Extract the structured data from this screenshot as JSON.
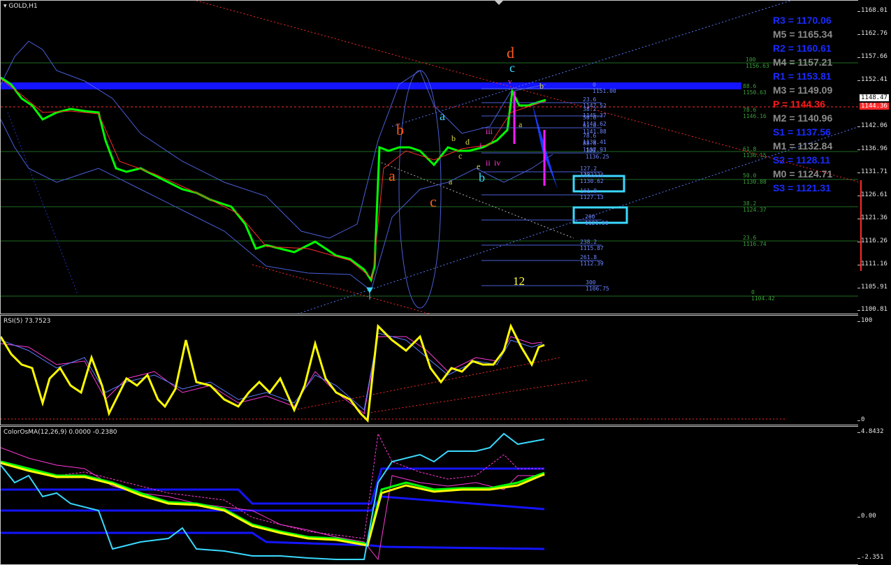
{
  "window": {
    "title": "GOLD,H1",
    "menu_icon": "triangle-down-icon"
  },
  "price_axis": {
    "ticks": [
      "1168.01",
      "1162.76",
      "1157.66",
      "1152.41",
      "1147.06",
      "1142.06",
      "1136.96",
      "1131.71",
      "1126.61",
      "1121.36",
      "1116.26",
      "1111.16",
      "1105.91",
      "1100.81"
    ],
    "current_price": "1148.47",
    "bid_label": "1144.36"
  },
  "pivots": [
    {
      "label": "R3 = 1170.06",
      "color": "#1a2bff"
    },
    {
      "label": "M5 = 1165.34",
      "color": "#8c8c8c"
    },
    {
      "label": "R2 = 1160.61",
      "color": "#1a2bff"
    },
    {
      "label": "M4 = 1157.21",
      "color": "#8c8c8c"
    },
    {
      "label": "R1 = 1153.81",
      "color": "#1a2bff"
    },
    {
      "label": "M3 = 1149.09",
      "color": "#8c8c8c"
    },
    {
      "label": "P  = 1144.36",
      "color": "#ff1a1a"
    },
    {
      "label": "M2 = 1140.96",
      "color": "#8c8c8c"
    },
    {
      "label": "S1 = 1137.56",
      "color": "#1a2bff"
    },
    {
      "label": "M1 = 1132.84",
      "color": "#8c8c8c"
    },
    {
      "label": "S2 = 1128.11",
      "color": "#1a2bff"
    },
    {
      "label": "M0 = 1124.71",
      "color": "#8c8c8c"
    },
    {
      "label": "S3 = 1121.31",
      "color": "#1a2bff"
    }
  ],
  "fib_blue": [
    "0 1151.00",
    "23.6 1147.52",
    "38.2 1145.37",
    "50.0 1143.62",
    "61.8 1141.88",
    "78.6 1139.41",
    "88.6 1137.93",
    "100 1136.25",
    "127.2 1132.24",
    "138.2 1130.62",
    "161.8 1127.13",
    "200 1121.50",
    "238.2 1115.87",
    "261.8 1112.39",
    "300 1106.75"
  ],
  "fib_green": [
    "100 1156.63",
    "88.6 1150.63",
    "78.6 1146.16",
    "61.8 1136.15",
    "50.0 1130.88",
    "38.2 1124.37",
    "23.6 1116.74",
    "0 1104.42"
  ],
  "waves": {
    "red": [
      "d",
      "b",
      "a",
      "c"
    ],
    "cyan": [
      "c",
      "a",
      "b"
    ],
    "magenta": [
      "v",
      "iii",
      "i",
      "ii",
      "iv"
    ],
    "yellow": [
      "b",
      "a",
      "b",
      "d",
      "a",
      "c",
      "e"
    ],
    "count": "12"
  },
  "rsi": {
    "title": "RSI(5) 73.7523",
    "ticks": [
      "100",
      "0"
    ]
  },
  "osma": {
    "title": "ColorOsMA(12,26,9) 0.0000 -0.2380",
    "ticks": [
      "4.8432",
      "0.00",
      "-2.351"
    ]
  },
  "colors": {
    "candles": "#00ff00",
    "pivot_band": "#1414ff",
    "rsi_line": "#ffff00",
    "osma_ma": "#ffff00",
    "osma_cyan": "#3ad9ff"
  }
}
